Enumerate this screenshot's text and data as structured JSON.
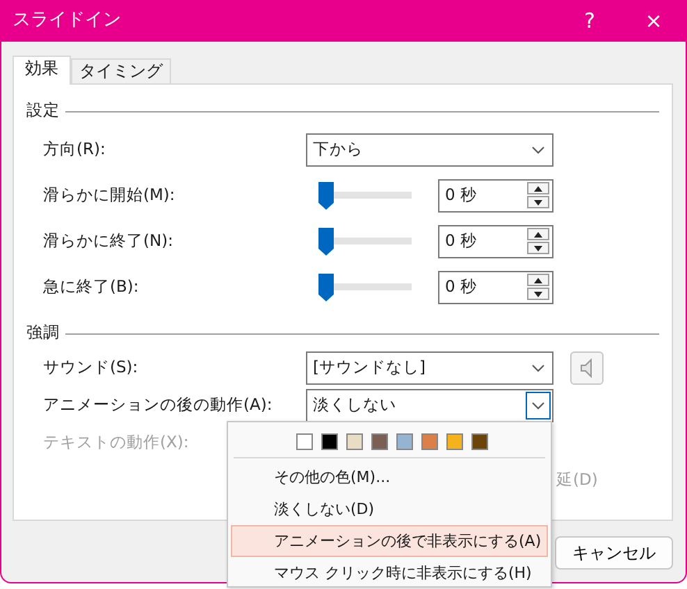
{
  "window": {
    "title": "スライドイン",
    "buttons": [
      "?",
      "×"
    ]
  },
  "tabs": [
    {
      "label": "効果",
      "selected": true
    },
    {
      "label": "タイミング",
      "selected": false
    }
  ],
  "sections": [
    {
      "heading": "設定",
      "rows": [
        {
          "kind": "combo",
          "label": "方向(R):",
          "value": "下から"
        },
        {
          "kind": "slider",
          "label": "滑らかに開始(M):",
          "level": 0,
          "value": "0 秒"
        },
        {
          "kind": "slider",
          "label": "滑らかに終了(N):",
          "level": 0,
          "value": "0 秒"
        },
        {
          "kind": "slider",
          "label": "急に終了(B):",
          "level": 0,
          "value": "0 秒"
        }
      ]
    },
    {
      "heading": "強調",
      "rows": [
        {
          "kind": "combo",
          "label": "サウンド(S):",
          "value": "[サウンドなし]",
          "sound_button": true
        },
        {
          "kind": "combo",
          "label": "アニメーションの後の動作(A):",
          "value": "淡くしない",
          "open": true
        },
        {
          "kind": "text",
          "label": "テキストの動作(X):",
          "disabled": true
        },
        {
          "kind": "tail",
          "label": "延(D)",
          "disabled": true
        }
      ]
    }
  ],
  "dropdown": {
    "colors": [
      {
        "color": "#ffffff"
      },
      {
        "color": "#000000"
      },
      {
        "color": "#e8dcc4"
      },
      {
        "color": "#7a5f55"
      },
      {
        "color": "#94b4d2"
      },
      {
        "color": "#dc804a"
      },
      {
        "color": "#f4b31c"
      },
      {
        "color": "#6b4409"
      }
    ],
    "items": [
      {
        "label": "その他の色(M)...",
        "selected": false
      },
      {
        "label": "淡くしない(D)",
        "selected": false
      },
      {
        "label": "アニメーションの後で非表示にする(A)",
        "selected": true
      },
      {
        "label": "マウス クリック時に非表示にする(H)",
        "selected": false
      }
    ]
  },
  "buttons": [
    "キャンセル"
  ]
}
